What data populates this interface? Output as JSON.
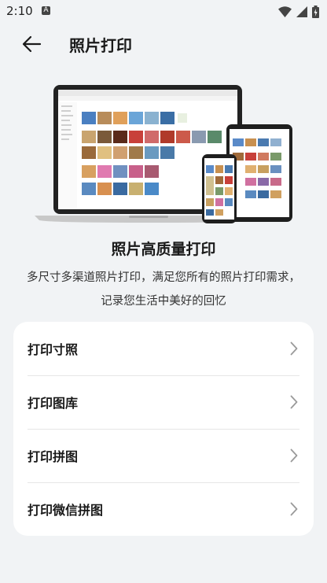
{
  "status": {
    "time": "2:10",
    "notification_letter": "A"
  },
  "header": {
    "title": "照片打印"
  },
  "hero": {
    "title": "照片高质量打印",
    "description_line1": "多尺寸多渠道照片打印，满足您所有的照片打印需求，",
    "description_line2": "记录您生活中美好的回忆"
  },
  "menu": {
    "items": [
      {
        "label": "打印寸照",
        "icon": "chevron-right-icon"
      },
      {
        "label": "打印图库",
        "icon": "chevron-right-icon"
      },
      {
        "label": "打印拼图",
        "icon": "chevron-right-icon"
      },
      {
        "label": "打印微信拼图",
        "icon": "chevron-right-icon"
      }
    ]
  },
  "colors": {
    "background": "#f1f3f5",
    "card": "#ffffff",
    "text": "#1a1a1a",
    "chevron": "#9a9a9a"
  }
}
